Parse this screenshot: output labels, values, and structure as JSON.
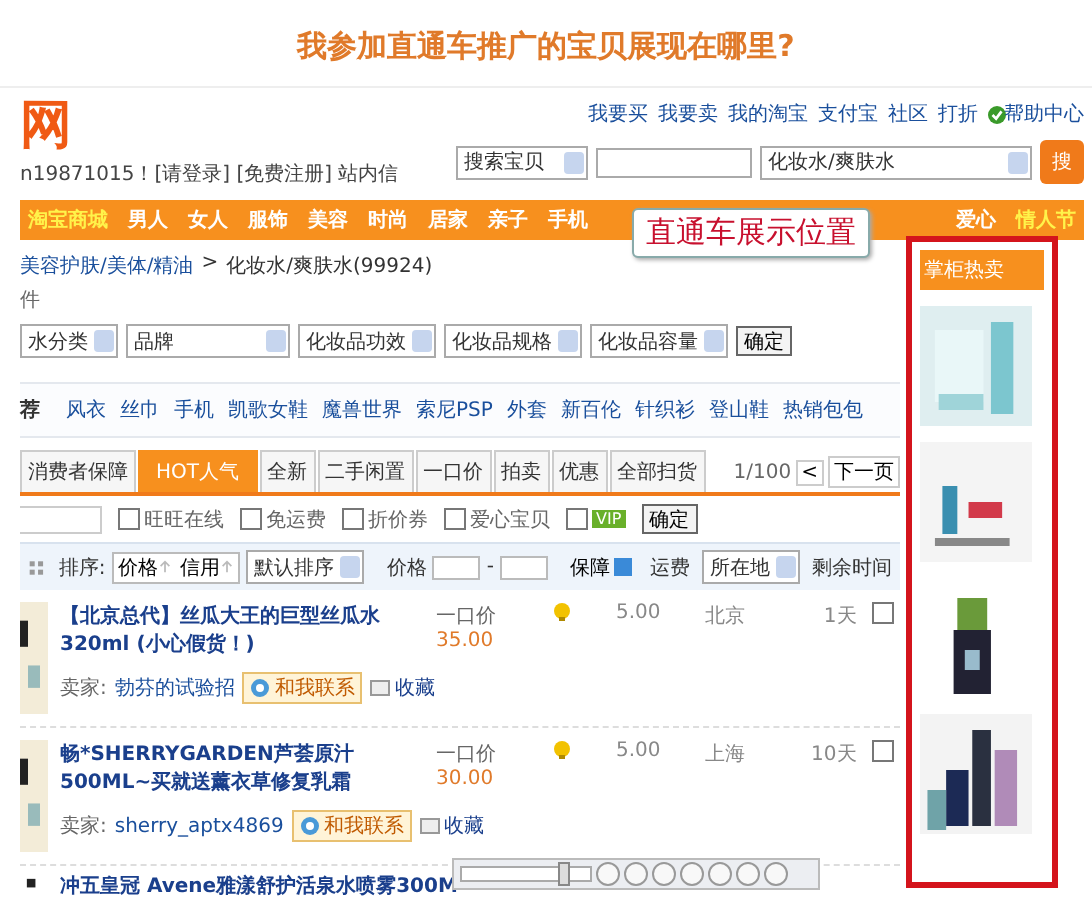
{
  "heading": "我参加直通车推广的宝贝展现在哪里?",
  "logo": "网",
  "login": "n19871015！[请登录] [免费注册] 站内信",
  "top_links": [
    "我要买",
    "我要卖",
    "我的淘宝",
    "支付宝",
    "社区",
    "打折",
    "帮助中心"
  ],
  "search": {
    "scope": "搜索宝贝",
    "category": "化妆水/爽肤水",
    "button": "搜"
  },
  "nav_left": [
    "淘宝商城",
    "男人",
    "女人",
    "服饰",
    "美容",
    "时尚",
    "居家",
    "亲子",
    "手机"
  ],
  "nav_right": [
    "爱心",
    "情人节"
  ],
  "callout": "直通车展示位置",
  "breadcrumb": {
    "path": "美容护肤/美体/精油",
    "separator": ">",
    "current": "化妆水/爽肤水(99924)"
  },
  "conditions_label": "件",
  "filters": [
    {
      "label": "水分类",
      "wide": false
    },
    {
      "label": "品牌",
      "wide": true
    },
    {
      "label": "化妆品功效",
      "wide": false
    },
    {
      "label": "化妆品规格",
      "wide": false
    },
    {
      "label": "化妆品容量",
      "wide": false
    }
  ],
  "filter_button": "确定",
  "hot_label": "荐",
  "hot_words": [
    "风衣",
    "丝巾",
    "手机",
    "凯歌女鞋",
    "魔兽世界",
    "索尼PSP",
    "外套",
    "新百伦",
    "针织衫",
    "登山鞋",
    "热销包包"
  ],
  "tabs": [
    {
      "label": "消费者保障",
      "selected": false
    },
    {
      "label": "HOT人气",
      "selected": true
    },
    {
      "label": "全新",
      "selected": false
    },
    {
      "label": "二手闲置",
      "selected": false
    },
    {
      "label": "一口价",
      "selected": false
    },
    {
      "label": "拍卖",
      "selected": false
    },
    {
      "label": "优惠",
      "selected": false
    },
    {
      "label": "全部扫货",
      "selected": false
    }
  ],
  "pager": {
    "page": "1/100",
    "prev": "<",
    "next": "下一页"
  },
  "options": [
    {
      "label": "旺旺在线",
      "checked": false,
      "kind": "text"
    },
    {
      "label": "免运费",
      "checked": false,
      "kind": "text"
    },
    {
      "label": "折价券",
      "checked": false,
      "kind": "text"
    },
    {
      "label": "爱心宝贝",
      "checked": false,
      "kind": "text"
    },
    {
      "label": "VIP",
      "checked": false,
      "kind": "badge"
    }
  ],
  "options_button": "确定",
  "sort": {
    "label": "排序:",
    "keys": [
      "价格",
      "信用"
    ],
    "order": "默认排序",
    "price_label": "价格",
    "dash": "-",
    "guarantee": "保障",
    "shipping": "运费",
    "location": "所在地",
    "time_left": "剩余时间"
  },
  "items": [
    {
      "title": "【北京总代】丝瓜大王的巨型丝瓜水 320ml (小心假货！)",
      "price_label": "一口价",
      "price": "35.00",
      "shipping": "5.00",
      "location": "北京",
      "time_left": "1天",
      "seller_label": "卖家:",
      "seller": "勃芬的试验招",
      "contact": "和我联系",
      "favorite": "收藏",
      "checked": false
    },
    {
      "title": "畅*SHERRYGARDEN芦荟原汁500ML~买就送薰衣草修复乳霜",
      "price_label": "一口价",
      "price": "30.00",
      "shipping": "5.00",
      "location": "上海",
      "time_left": "10天",
      "seller_label": "卖家:",
      "seller": "sherry_aptx4869",
      "contact": "和我联系",
      "favorite": "收藏",
      "checked": false
    }
  ],
  "partial_item": "冲五皇冠 Avene雅漾舒护活泉水喷雾300M",
  "player": {
    "level": 0.8
  },
  "sidebar": {
    "title": "掌柜热卖"
  }
}
